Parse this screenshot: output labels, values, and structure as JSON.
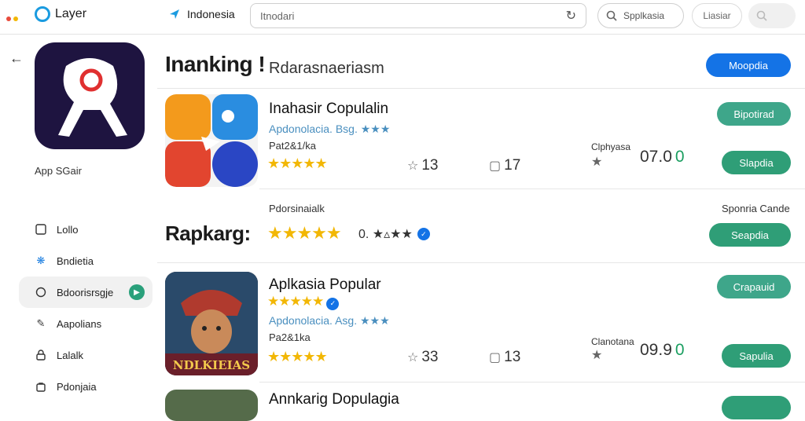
{
  "topbar": {
    "brand": "Layer",
    "region": "Indonesia",
    "url_text": "Itnodari",
    "search_label": "Spplkasia",
    "lite_button": "Liasiar"
  },
  "sidebar": {
    "app_label": "App SGair",
    "items": [
      {
        "label": "Lollo",
        "icon": "square-icon"
      },
      {
        "label": "Bndietia",
        "icon": "gear-icon"
      },
      {
        "label": "Bdoorisrsgje",
        "icon": "chat-icon"
      },
      {
        "label": "Aapolians",
        "icon": "wrench-icon"
      },
      {
        "label": "Lalalk",
        "icon": "lock-icon"
      },
      {
        "label": "Pdonjaia",
        "icon": "bag-icon"
      }
    ]
  },
  "main": {
    "heading": "Inanking !",
    "heading_sub": "Rdarasnaeriasm",
    "heading_button": "Moopdia",
    "row1": {
      "title": "Inahasir Copulalin",
      "subtitle": "Apdonolacia. Bsg. ★★★",
      "publisher": "Pat2&1/ka",
      "stars": "★★★★★",
      "reviews": "13",
      "downloads": "17",
      "price_label": "Clphyasa",
      "price": "07.0",
      "button_top": "Bipotirad",
      "button_bottom": "Slapdia"
    },
    "section": {
      "small_label": "Pdorsinaialk",
      "right_label": "Sponria Cande",
      "title": "Rapkarg:",
      "stars": "★★★★★",
      "rating": "0. ★▵★★",
      "button": "Seapdia"
    },
    "row2": {
      "title": "Aplkasia Popular",
      "stars_top": "★★★★★",
      "subtitle": "Apdonolacia. Asg. ★★★",
      "publisher": "Pa2&1ka",
      "stars": "★★★★★",
      "reviews": "33",
      "downloads": "13",
      "price_label": "Clanotana",
      "price": "09.9",
      "button_top": "Crapauid",
      "button_bottom": "Sapulia",
      "thumb_text": "NDLKIEIAS"
    },
    "row3": {
      "title": "Annkarig Dopulagia"
    }
  }
}
